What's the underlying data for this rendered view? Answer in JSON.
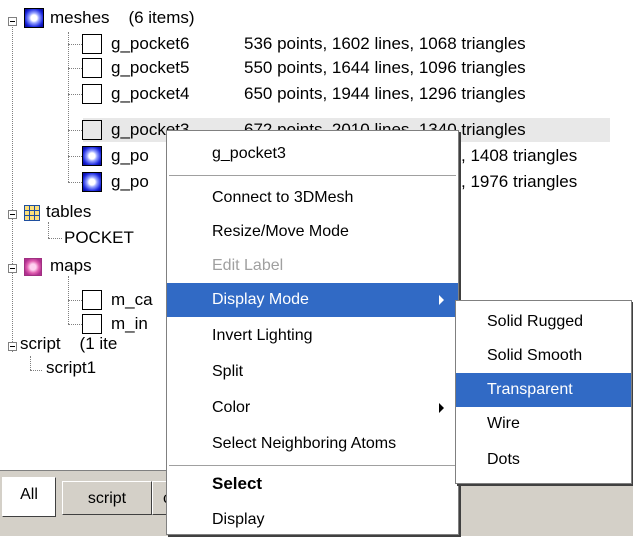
{
  "tree": {
    "meshes_label": "meshes",
    "meshes_count": "(6 items)",
    "items": [
      {
        "name": "g_pocket6",
        "info": "536 points, 1602 lines, 1068 triangles",
        "icon": "blank-square-icon"
      },
      {
        "name": "g_pocket5",
        "info": "550 points, 1644 lines, 1096 triangles",
        "icon": "blank-square-icon"
      },
      {
        "name": "g_pocket4",
        "info": "650 points, 1944 lines, 1296 triangles",
        "icon": "blank-square-icon"
      },
      {
        "name": "g_pocket3",
        "info": "672 points, 2010 lines, 1340 triangles",
        "icon": "blank-square-icon"
      },
      {
        "name": "g_po",
        "info": ", 1408 triangles",
        "icon": "blue-sphere-icon"
      },
      {
        "name": "g_po",
        "info": ", 1976 triangles",
        "icon": "blue-sphere-icon"
      }
    ],
    "tables_label": "tables",
    "pocket_label": "POCKET",
    "maps_label": "maps",
    "map_items": [
      "m_ca",
      "m_in"
    ],
    "script_label": "script",
    "script_count": "(1 ite",
    "script_item": "script1"
  },
  "tabs": [
    "All",
    "script",
    "c"
  ],
  "context_menu": {
    "header": "g_pocket3",
    "items": [
      "Connect to 3DMesh",
      "Resize/Move Mode",
      "Edit Label",
      "Display Mode",
      "Invert Lighting",
      "Split",
      "Color",
      "Select Neighboring Atoms"
    ],
    "bold_item": "Select",
    "last_item": "Display"
  },
  "submenu": {
    "items": [
      "Solid Rugged",
      "Solid Smooth",
      "Transparent",
      "Wire",
      "Dots"
    ]
  },
  "colors": {
    "highlight": "#316ac5",
    "panel": "#d4d0c8"
  }
}
